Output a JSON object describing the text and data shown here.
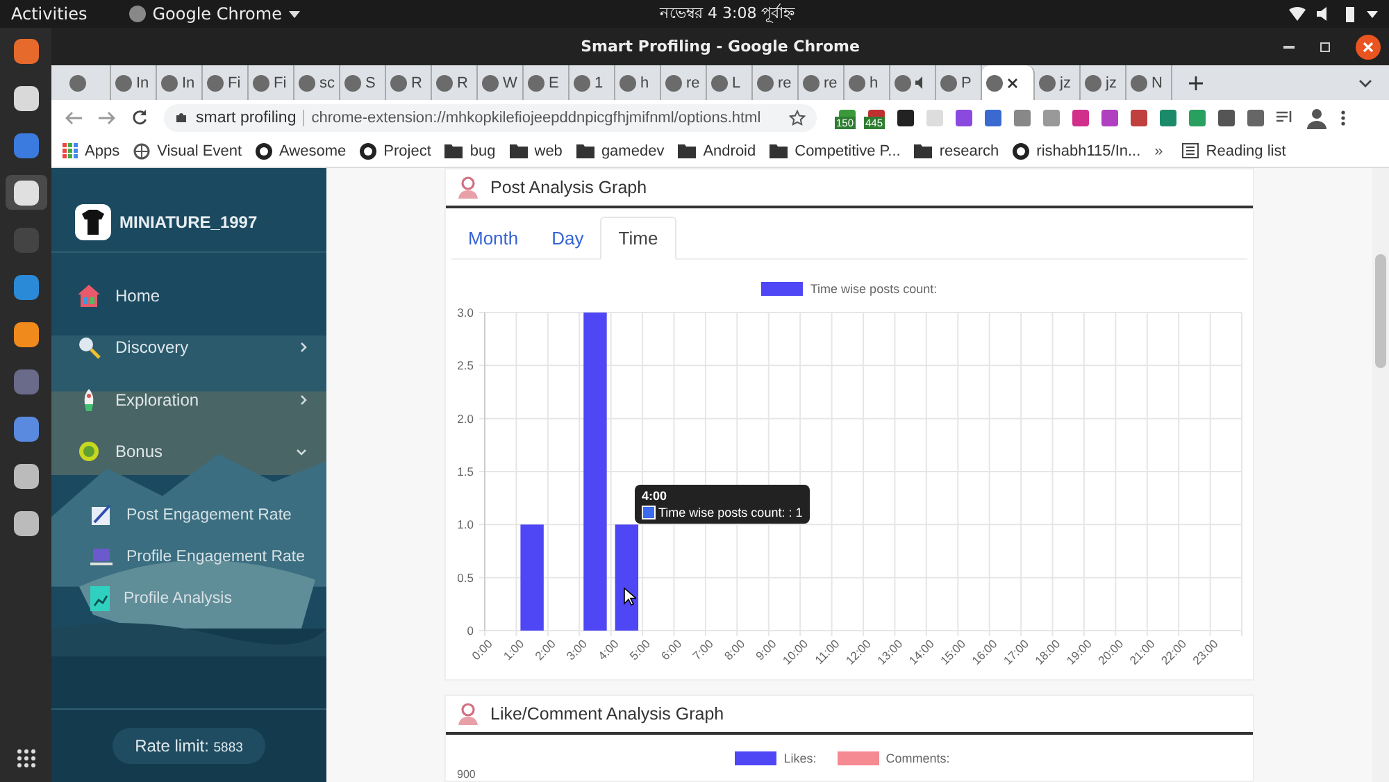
{
  "topbar": {
    "activities": "Activities",
    "app": "Google Chrome",
    "clock": "নভেম্বর 4  3:08 পূর্বাহ্ন"
  },
  "dock": [
    {
      "selected": false
    },
    {
      "selected": false
    },
    {
      "selected": false
    },
    {
      "selected": true
    },
    {
      "selected": false
    },
    {
      "selected": false
    },
    {
      "selected": false
    },
    {
      "selected": false
    },
    {
      "selected": false
    },
    {
      "selected": false
    },
    {
      "selected": false
    }
  ],
  "window": {
    "title": "Smart Profiling - Google Chrome"
  },
  "tabs": [
    {
      "selected": false
    },
    {
      "label": "In",
      "selected": false
    },
    {
      "label": "In",
      "selected": false
    },
    {
      "label": "Fi",
      "selected": false
    },
    {
      "label": "Fi",
      "selected": false
    },
    {
      "label": "sc",
      "selected": false
    },
    {
      "label": "S",
      "selected": false
    },
    {
      "label": "R",
      "selected": false
    },
    {
      "label": "R",
      "selected": false
    },
    {
      "label": "W",
      "selected": false
    },
    {
      "label": "E",
      "selected": false
    },
    {
      "label": "1",
      "selected": false
    },
    {
      "label": "h",
      "selected": false
    },
    {
      "label": "re",
      "selected": false
    },
    {
      "label": "L",
      "selected": false
    },
    {
      "label": "re",
      "selected": false
    },
    {
      "label": "re",
      "selected": false
    },
    {
      "label": "h",
      "selected": false
    },
    {
      "selected": false,
      "audio": true
    },
    {
      "label": "P",
      "selected": false
    },
    {
      "selected": true
    },
    {
      "label": "jz",
      "selected": false
    },
    {
      "label": "jz",
      "selected": false
    },
    {
      "label": "N",
      "selected": false
    }
  ],
  "address": {
    "site": "smart profiling",
    "url": "chrome-extension://mhkopkilefiojeepddnpicgfhjmifnml/options.html"
  },
  "extension_badges": [
    "150",
    "445"
  ],
  "bookmarks": [
    {
      "kind": "apps",
      "label": "Apps"
    },
    {
      "kind": "globe",
      "label": "Visual Event"
    },
    {
      "kind": "github",
      "label": "Awesome"
    },
    {
      "kind": "github",
      "label": "Project"
    },
    {
      "kind": "folder",
      "label": "bug"
    },
    {
      "kind": "folder",
      "label": "web"
    },
    {
      "kind": "folder",
      "label": "gamedev"
    },
    {
      "kind": "folder",
      "label": "Android"
    },
    {
      "kind": "folder",
      "label": "Competitive P..."
    },
    {
      "kind": "folder",
      "label": "research"
    },
    {
      "kind": "github",
      "label": "rishabh115/In..."
    }
  ],
  "bookmarks_more": "»",
  "reading_list": "Reading list",
  "sidebar": {
    "username": "MINIATURE_1997",
    "items": [
      {
        "label": "Home",
        "kind": "home"
      },
      {
        "label": "Discovery",
        "kind": "discovery",
        "expandable": true,
        "expanded": false
      },
      {
        "label": "Exploration",
        "kind": "exploration",
        "expandable": true,
        "expanded": false
      },
      {
        "label": "Bonus",
        "kind": "bonus",
        "expandable": true,
        "expanded": true,
        "children": [
          {
            "label": "Post Engagement Rate",
            "kind": "post"
          },
          {
            "label": "Profile Engagement Rate",
            "kind": "profile"
          },
          {
            "label": "Profile Analysis",
            "kind": "analysis"
          }
        ]
      }
    ],
    "rate_label": "Rate limit:",
    "rate_value": "5883"
  },
  "post_card": {
    "title": "Post Analysis Graph",
    "tabs": [
      {
        "label": "Month",
        "selected": false
      },
      {
        "label": "Day",
        "selected": false
      },
      {
        "label": "Time",
        "selected": true
      }
    ],
    "chart_data": {
      "type": "bar",
      "grid": true,
      "categories": [
        "0:00",
        "1:00",
        "2:00",
        "3:00",
        "4:00",
        "5:00",
        "6:00",
        "7:00",
        "8:00",
        "9:00",
        "10:00",
        "11:00",
        "12:00",
        "13:00",
        "14:00",
        "15:00",
        "16:00",
        "17:00",
        "18:00",
        "19:00",
        "20:00",
        "21:00",
        "22:00",
        "23:00"
      ],
      "series": [
        {
          "name": "Time wise posts count:",
          "color": "#4f46f5",
          "values": [
            0,
            1,
            0,
            3,
            1,
            0,
            0,
            0,
            0,
            0,
            0,
            0,
            0,
            0,
            0,
            0,
            0,
            0,
            0,
            0,
            0,
            0,
            0,
            0
          ]
        }
      ],
      "ylim": [
        0,
        3
      ],
      "yticks": [
        {
          "value": 0,
          "label": "0"
        },
        {
          "value": 0.5,
          "label": "0.5"
        },
        {
          "value": 1,
          "label": "1.0"
        },
        {
          "value": 1.5,
          "label": "1.5"
        },
        {
          "value": 2,
          "label": "2.0"
        },
        {
          "value": 2.5,
          "label": "2.5"
        },
        {
          "value": 3,
          "label": "3.0"
        }
      ]
    },
    "tooltip": {
      "title": "4:00",
      "text": "Time wise posts count: : 1"
    }
  },
  "like_card": {
    "title": "Like/Comment Analysis Graph",
    "legend": [
      {
        "name": "Likes:",
        "color": "#4f46f5"
      },
      {
        "name": "Comments:",
        "color": "#f58a92"
      }
    ],
    "ytick": "900"
  }
}
